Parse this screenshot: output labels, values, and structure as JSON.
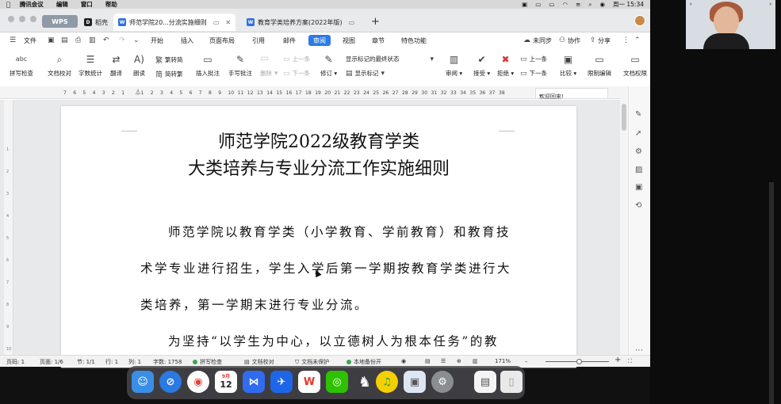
{
  "menubar": {
    "apple": "",
    "items": [
      "腾讯会议",
      "编辑",
      "窗口",
      "帮助"
    ],
    "clock": "周一 15:34"
  },
  "tabbar": {
    "wps": "WPS",
    "tabs": [
      {
        "label": "稻壳",
        "icon": "D"
      },
      {
        "label": "师范学院20...分流实施细则",
        "icon": "W"
      },
      {
        "label": "教育学类培养方案(2022年版)",
        "icon": "W"
      }
    ],
    "new_tab": "+"
  },
  "menu": {
    "file": "文件",
    "tabs": [
      "开始",
      "插入",
      "页面布局",
      "引用",
      "邮件",
      "审阅",
      "视图",
      "章节",
      "特色功能"
    ],
    "active": "审阅",
    "sync": "未同步",
    "collab": "协作",
    "share": "分享"
  },
  "ribbon": {
    "spellcheck": "拼写检查",
    "spellcheck_icon": "abc",
    "doccheck": "文档校对",
    "wordcount": "字数统计",
    "translate": "翻译",
    "read": "朗读",
    "to_simplified": "繁转简",
    "to_traditional": "简转繁",
    "insert_comment": "插入批注",
    "handwrite_comment": "手写批注",
    "delete": "删除",
    "prev_disabled": "上一条",
    "next_disabled": "下一条",
    "revise": "修订",
    "show_final": "显示标记的最终状态",
    "show_markup": "显示标记",
    "review": "审阅",
    "accept": "接受",
    "reject": "拒绝",
    "prev": "上一条",
    "next": "下一条",
    "compare": "比较",
    "restrict": "限制编辑",
    "doc_rights": "文档权限"
  },
  "ruler": {
    "ticks": [
      "7",
      "6",
      "5",
      "4",
      "3",
      "2",
      "1",
      "",
      "1",
      "2",
      "3",
      "4",
      "5",
      "6",
      "7",
      "8",
      "9",
      "10",
      "11",
      "12",
      "13",
      "14",
      "15",
      "16",
      "17",
      "18",
      "19",
      "20",
      "21",
      "22",
      "23",
      "24",
      "25",
      "26",
      "27",
      "28",
      "29",
      "30",
      "31",
      "32",
      "33",
      "34",
      "35",
      "36",
      "37",
      "38"
    ],
    "welcome": "欢迎回来!"
  },
  "vruler": [
    "1",
    "2",
    "3",
    "4",
    "5",
    "6",
    "7",
    "8",
    "9",
    "10"
  ],
  "document": {
    "title_line1": "师范学院2022级教育学类",
    "title_line2": "大类培养与专业分流工作实施细则",
    "para1_line1": "师范学院以教育学类（小学教育、学前教育）和教育技",
    "para1_line2": "术学专业进行招生，学生入学后第一学期按教育学类进行大",
    "para1_line3": "类培养，第一学期末进行专业分流。",
    "para2_line1": "为坚持“以学生为中心，以立德树人为根本任务”的教"
  },
  "status": {
    "page_code": "页码: 1",
    "page": "页面: 1/6",
    "section": "节: 1/1",
    "row": "行: 1",
    "col": "列: 1",
    "word_count": "字数: 1758",
    "spellcheck": "拼写检查",
    "proofread": "文档校对",
    "unprotected": "文档未保护",
    "backup": "本地备份开",
    "zoom": "171%",
    "zoom_minus": "–",
    "zoom_plus": "+"
  },
  "dock": {
    "calendar_month": "9月",
    "calendar_day": "12",
    "items": [
      "finder",
      "safari",
      "chrome",
      "calendar",
      "tencent-meeting",
      "feishu",
      "wps",
      "wechat",
      "qq",
      "qq-music",
      "preview",
      "system-settings",
      "document",
      "trash"
    ]
  },
  "colors": {
    "accent": "#2c7be5",
    "wps_red": "#e0382c",
    "menubar": "#d8d8d8",
    "canvas": "#e8e9eb"
  }
}
